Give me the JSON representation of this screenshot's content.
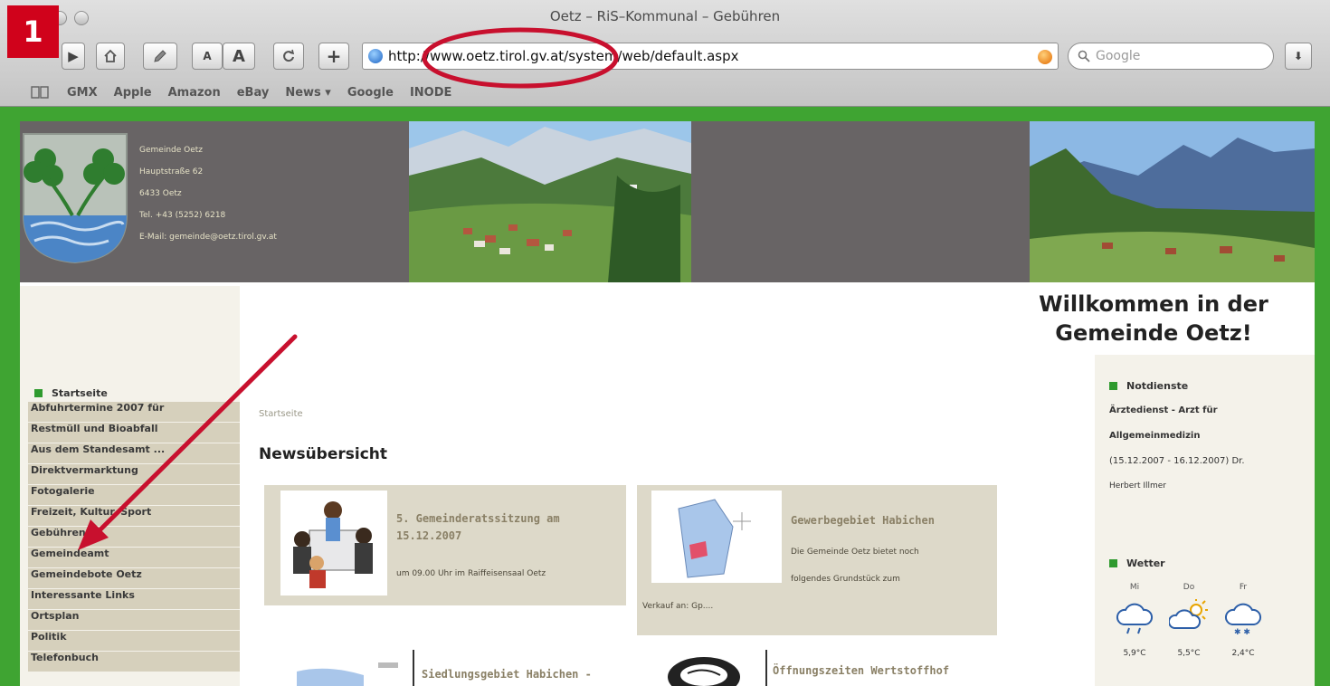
{
  "annotation": {
    "step_number": "1",
    "color": "#c8102e"
  },
  "browser": {
    "window_title": "Oetz – RiS–Kommunal – Gebühren",
    "url": "http://www.oetz.tirol.gv.at/system/web/default.aspx",
    "search_placeholder": "Google",
    "toolbar": {
      "font_small": "A",
      "font_large": "A",
      "add": "+"
    },
    "bookmarks": [
      "GMX",
      "Apple",
      "Amazon",
      "eBay",
      "News ▾",
      "Google",
      "INODE"
    ]
  },
  "site": {
    "address_lines": [
      "Gemeinde Oetz",
      "Hauptstraße 62",
      "6433 Oetz",
      "Tel. +43 (5252) 6218",
      "E-Mail: gemeinde@oetz.tirol.gv.at"
    ],
    "welcome_line1": "Willkommen in der",
    "welcome_line2": "Gemeinde Oetz!",
    "brand_green": "#3fa432"
  },
  "nav": {
    "heading": "Startseite",
    "items": [
      "Abfuhrtermine 2007 für",
      "Restmüll und Bioabfall",
      "Aus dem Standesamt ...",
      "Direktvermarktung",
      "Fotogalerie",
      "Freizeit, Kultur, Sport",
      "Gebühren",
      "Gemeindeamt",
      "Gemeindebote Oetz",
      "Interessante Links",
      "Ortsplan",
      "Politik",
      "Telefonbuch"
    ]
  },
  "main": {
    "breadcrumb": "Startseite",
    "title": "Newsübersicht",
    "news": [
      {
        "heading_l1": "5. Gemeinderatssitzung am",
        "heading_l2": "15.12.2007",
        "text": "um 09.00 Uhr im Raiffeisensaal Oetz"
      },
      {
        "heading_l1": "Gewerbegebiet Habichen",
        "text_l1": "Die Gemeinde Oetz bietet noch",
        "text_l2": "folgendes Grundstück zum",
        "text_l3": "Verkauf an: Gp...."
      },
      {
        "heading_l1": "Siedlungsgebiet Habichen -"
      },
      {
        "heading_l1": "Öffnungszeiten Wertstoffhof"
      }
    ]
  },
  "right": {
    "notdienste_heading": "Notdienste",
    "notdienste_lines": [
      "Ärztedienst - Arzt für",
      "Allgemeinmedizin",
      "(15.12.2007 - 16.12.2007) Dr.",
      "Herbert Illmer"
    ],
    "wetter_heading": "Wetter",
    "weather": [
      {
        "day": "Mi",
        "icon": "rain-cloud-icon",
        "temp": "5,9°C"
      },
      {
        "day": "Do",
        "icon": "sun-cloud-icon",
        "temp": "5,5°C"
      },
      {
        "day": "Fr",
        "icon": "snow-cloud-icon",
        "temp": "2,4°C"
      }
    ]
  }
}
